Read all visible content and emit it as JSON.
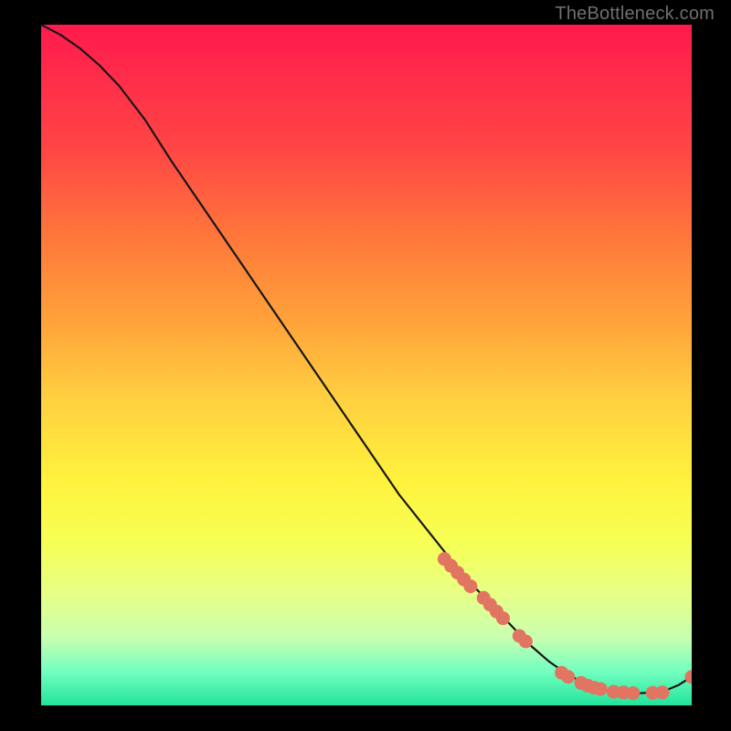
{
  "watermark": "TheBottleneck.com",
  "colors": {
    "page_bg": "#000000",
    "curve": "#171717",
    "dot": "#e27462",
    "watermark": "#6f6f6f",
    "gradient": [
      "#ff1a4d",
      "#ff4545",
      "#ff7a3a",
      "#ffa43a",
      "#ffd040",
      "#fff23d",
      "#f6ff55",
      "#e9ff82",
      "#c9ffb0",
      "#73ffc0",
      "#22e39b"
    ]
  },
  "chart_data": {
    "type": "line",
    "title": "",
    "xlabel": "",
    "ylabel": "",
    "xlim": [
      0,
      100
    ],
    "ylim": [
      0,
      100
    ],
    "series": [
      {
        "name": "curve",
        "x": [
          0,
          3,
          6,
          9,
          12,
          16,
          20,
          25,
          30,
          35,
          40,
          45,
          50,
          55,
          60,
          65,
          70,
          75,
          78,
          81,
          84,
          86,
          88,
          90,
          92,
          94,
          96,
          98,
          100
        ],
        "y": [
          100,
          98.5,
          96.5,
          94,
          91,
          86,
          80,
          73,
          66,
          59,
          52,
          45,
          38,
          31,
          25,
          19,
          14,
          9,
          6.5,
          4.5,
          3,
          2.3,
          1.9,
          1.8,
          1.8,
          1.9,
          2.2,
          3.0,
          4.2
        ]
      }
    ],
    "markers": {
      "name": "dots",
      "x": [
        62,
        63,
        64,
        65,
        66,
        68,
        69,
        70,
        71,
        73.5,
        74.5,
        80,
        81,
        83,
        84,
        85,
        86,
        88,
        89.5,
        91,
        94,
        95.5,
        100
      ],
      "y": [
        21.5,
        20.5,
        19.5,
        18.5,
        17.5,
        15.8,
        14.8,
        13.8,
        12.8,
        10.2,
        9.4,
        4.8,
        4.2,
        3.3,
        2.9,
        2.6,
        2.4,
        2.0,
        1.9,
        1.8,
        1.85,
        1.9,
        4.2
      ]
    }
  }
}
